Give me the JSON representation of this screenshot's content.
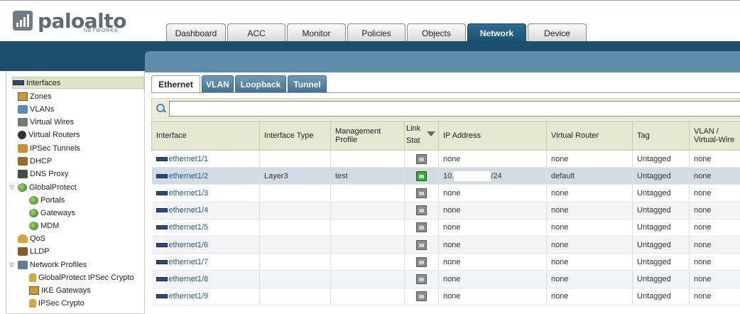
{
  "brand": {
    "name": "paloalto",
    "sub": "NETWORKS"
  },
  "top_tabs": [
    {
      "label": "Dashboard",
      "active": false
    },
    {
      "label": "ACC",
      "active": false
    },
    {
      "label": "Monitor",
      "active": false
    },
    {
      "label": "Policies",
      "active": false
    },
    {
      "label": "Objects",
      "active": false
    },
    {
      "label": "Network",
      "active": true
    },
    {
      "label": "Device",
      "active": false
    }
  ],
  "sidebar": {
    "items": [
      {
        "label": "Interfaces",
        "icon": "interfaces-icon",
        "selected": true
      },
      {
        "label": "Zones",
        "icon": "zones-icon"
      },
      {
        "label": "VLANs",
        "icon": "vlans-icon"
      },
      {
        "label": "Virtual Wires",
        "icon": "virtual-wires-icon"
      },
      {
        "label": "Virtual Routers",
        "icon": "virtual-routers-icon"
      },
      {
        "label": "IPSec Tunnels",
        "icon": "ipsec-tunnels-icon"
      },
      {
        "label": "DHCP",
        "icon": "dhcp-icon"
      },
      {
        "label": "DNS Proxy",
        "icon": "dns-proxy-icon"
      },
      {
        "label": "GlobalProtect",
        "icon": "globalprotect-icon",
        "expanded": true
      },
      {
        "label": "Portals",
        "icon": "portals-icon"
      },
      {
        "label": "Gateways",
        "icon": "gateways-icon"
      },
      {
        "label": "MDM",
        "icon": "mdm-icon"
      },
      {
        "label": "QoS",
        "icon": "qos-icon"
      },
      {
        "label": "LLDP",
        "icon": "lldp-icon"
      },
      {
        "label": "Network Profiles",
        "icon": "network-profiles-icon",
        "expanded": true
      },
      {
        "label": "GlobalProtect IPSec Crypto",
        "icon": "lock-icon"
      },
      {
        "label": "IKE Gateways",
        "icon": "ike-gateways-icon"
      },
      {
        "label": "IPSec Crypto",
        "icon": "lock-icon"
      }
    ]
  },
  "sub_tabs": [
    {
      "label": "Ethernet",
      "active": true
    },
    {
      "label": "VLAN",
      "active": false
    },
    {
      "label": "Loopback",
      "active": false
    },
    {
      "label": "Tunnel",
      "active": false
    }
  ],
  "filter": {
    "value": "",
    "placeholder": ""
  },
  "table": {
    "headers": [
      "Interface",
      "Interface Type",
      "Management Profile",
      "Link State",
      "IP Address",
      "Virtual Router",
      "Tag",
      "VLAN / Virtual-Wire"
    ],
    "header_display": {
      "mgmt_line1": "Management",
      "mgmt_line2": "Profile",
      "link_line1": "Link",
      "link_line2": "Stat",
      "vlan_line1": "VLAN /",
      "vlan_line2": "Virtual-Wire"
    },
    "rows": [
      {
        "interface": "ethernet1/1",
        "type": "",
        "profile": "",
        "link_up": false,
        "ip": "none",
        "ip_prefix": "",
        "ip_suffix": "",
        "router": "none",
        "tag": "Untagged",
        "vlan": "none"
      },
      {
        "interface": "ethernet1/2",
        "type": "Layer3",
        "profile": "test",
        "link_up": true,
        "ip": "",
        "ip_prefix": "10.",
        "ip_suffix": "/24",
        "router": "default",
        "tag": "Untagged",
        "vlan": "none",
        "selected": true
      },
      {
        "interface": "ethernet1/3",
        "type": "",
        "profile": "",
        "link_up": false,
        "ip": "none",
        "ip_prefix": "",
        "ip_suffix": "",
        "router": "none",
        "tag": "Untagged",
        "vlan": "none"
      },
      {
        "interface": "ethernet1/4",
        "type": "",
        "profile": "",
        "link_up": false,
        "ip": "none",
        "ip_prefix": "",
        "ip_suffix": "",
        "router": "none",
        "tag": "Untagged",
        "vlan": "none"
      },
      {
        "interface": "ethernet1/5",
        "type": "",
        "profile": "",
        "link_up": false,
        "ip": "none",
        "ip_prefix": "",
        "ip_suffix": "",
        "router": "none",
        "tag": "Untagged",
        "vlan": "none"
      },
      {
        "interface": "ethernet1/6",
        "type": "",
        "profile": "",
        "link_up": false,
        "ip": "none",
        "ip_prefix": "",
        "ip_suffix": "",
        "router": "none",
        "tag": "Untagged",
        "vlan": "none"
      },
      {
        "interface": "ethernet1/7",
        "type": "",
        "profile": "",
        "link_up": false,
        "ip": "none",
        "ip_prefix": "",
        "ip_suffix": "",
        "router": "none",
        "tag": "Untagged",
        "vlan": "none"
      },
      {
        "interface": "ethernet1/8",
        "type": "",
        "profile": "",
        "link_up": false,
        "ip": "none",
        "ip_prefix": "",
        "ip_suffix": "",
        "router": "none",
        "tag": "Untagged",
        "vlan": "none"
      },
      {
        "interface": "ethernet1/9",
        "type": "",
        "profile": "",
        "link_up": false,
        "ip": "none",
        "ip_prefix": "",
        "ip_suffix": "",
        "router": "none",
        "tag": "Untagged",
        "vlan": "none"
      }
    ]
  },
  "colors": {
    "brand_blue": "#1c4f6e",
    "panel_blue": "#5e8daa",
    "header_green": "#e5e9d1",
    "selected_row": "#d3dce5",
    "link_up_green": "#3aa63a"
  }
}
